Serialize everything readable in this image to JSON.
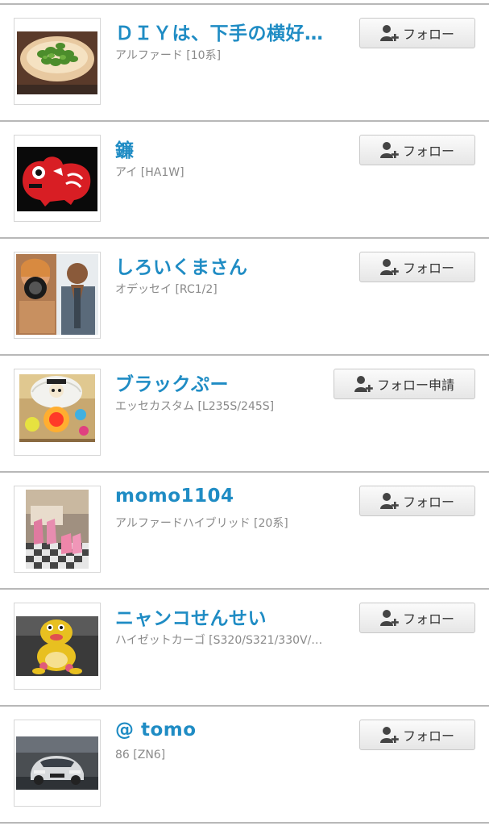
{
  "users": [
    {
      "name": "ＤＩＹは、下手の横好…",
      "car": "アルファード [10系]",
      "button_label": "フォロー",
      "thumb_icon": "green-beans-photo"
    },
    {
      "name": "鐮",
      "car": "アイ [HA1W]",
      "button_label": "フォロー",
      "thumb_icon": "red-cow-photo"
    },
    {
      "name": "しろいくまさん",
      "car": "オデッセイ [RC1/2]",
      "button_label": "フォロー",
      "thumb_icon": "people-photo"
    },
    {
      "name": "ブラックぷー",
      "car": "エッセカスタム [L235S/245S]",
      "button_label": "フォロー申請",
      "thumb_icon": "pirate-lantern-photo"
    },
    {
      "name": "momo1104",
      "car": "アルファードハイブリッド [20系]",
      "button_label": "フォロー",
      "thumb_icon": "pink-shoes-photo"
    },
    {
      "name": "ニャンコせんせい",
      "car": "ハイゼットカーゴ [S320/S321/330V/…",
      "button_label": "フォロー",
      "thumb_icon": "cat-figure-photo"
    },
    {
      "name": "@ tomo",
      "car": "86 [ZN6]",
      "button_label": "フォロー",
      "thumb_icon": "white-car-photo"
    }
  ],
  "colors": {
    "name": "#1f8cc4",
    "subtext": "#8a8a8a",
    "divider": "#b8b8b8"
  }
}
